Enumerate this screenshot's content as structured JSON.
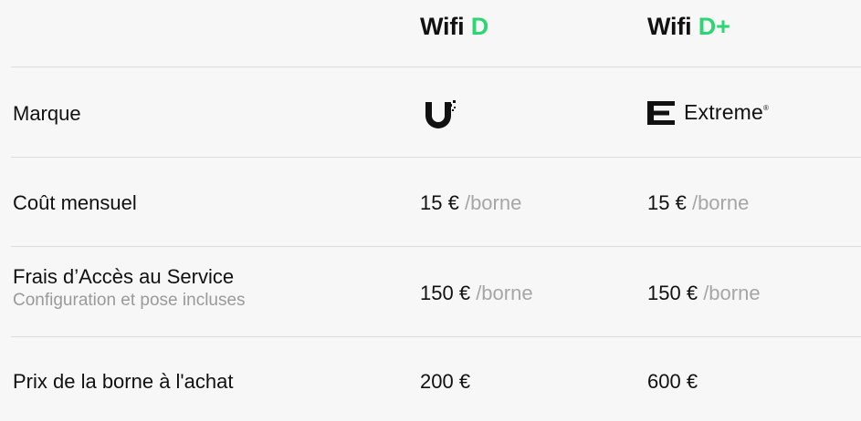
{
  "header": {
    "plans": [
      {
        "prefix": "Wifi",
        "suffix": "D"
      },
      {
        "prefix": "Wifi",
        "suffix": "D+"
      }
    ]
  },
  "rows": {
    "brand": {
      "label": "Marque",
      "plan_a_logo": "ubiquiti-logo-icon",
      "plan_b_logo": "extreme-logo-icon",
      "plan_b_text": "Extreme"
    },
    "monthly": {
      "label": "Coût mensuel",
      "plan_a_value": "15 €",
      "plan_a_unit": "/borne",
      "plan_b_value": "15 €",
      "plan_b_unit": "/borne"
    },
    "access_fee": {
      "label": "Frais d’Accès au Service",
      "sublabel": "Configuration et pose incluses",
      "plan_a_value": "150 €",
      "plan_a_unit": "/borne",
      "plan_b_value": "150 €",
      "plan_b_unit": "/borne"
    },
    "purchase": {
      "label": "Prix de la borne à l'achat",
      "plan_a_value": "200 €",
      "plan_b_value": "600 €"
    }
  },
  "colors": {
    "accent": "#2ed573",
    "text": "#111111",
    "muted": "#a6a6a6",
    "background": "#f7f7f7",
    "divider": "#dddddd"
  }
}
